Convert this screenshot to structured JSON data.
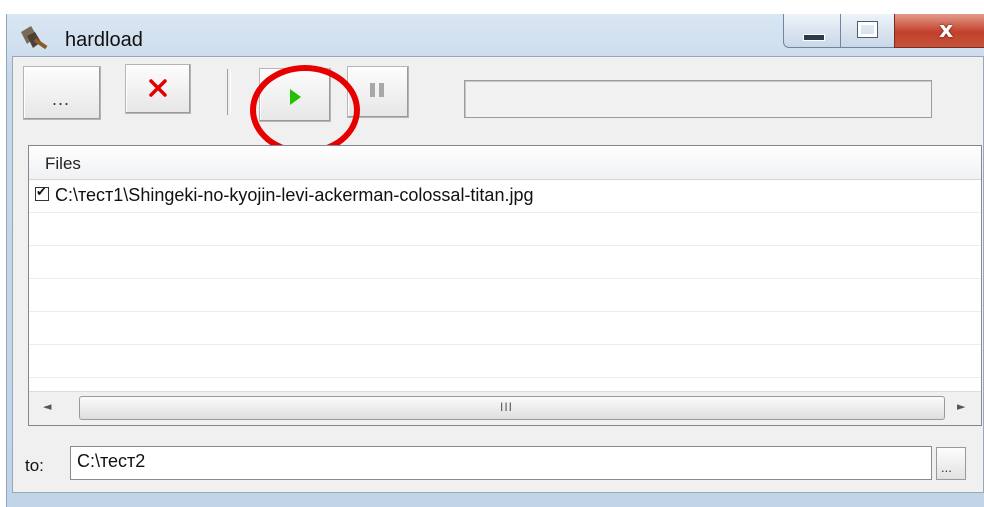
{
  "window": {
    "title": "hardload",
    "controls": {
      "minimize": "minimize",
      "maximize": "maximize",
      "close": "x"
    }
  },
  "toolbar": {
    "browse_files_label": "...",
    "remove_label": "✕",
    "start_label": "▶",
    "pause_label": "II",
    "progress": 0
  },
  "files": {
    "header": "Files",
    "items": [
      {
        "checked": true,
        "path": "C:\\тест1\\Shingeki-no-kyojin-levi-ackerman-colossal-titan.jpg"
      }
    ]
  },
  "scrollbar": {
    "left_arrow": "◄",
    "right_arrow": "►",
    "grip": "III"
  },
  "destination": {
    "label": "to:",
    "value": "C:\\тест2",
    "browse_label": "..."
  },
  "colors": {
    "annotation_ring": "#e60000",
    "play_green": "#22c000",
    "remove_red": "#e00000"
  },
  "icons": [
    "shovel-app-icon",
    "remove-icon",
    "play-icon",
    "pause-icon",
    "checkbox-icon"
  ]
}
